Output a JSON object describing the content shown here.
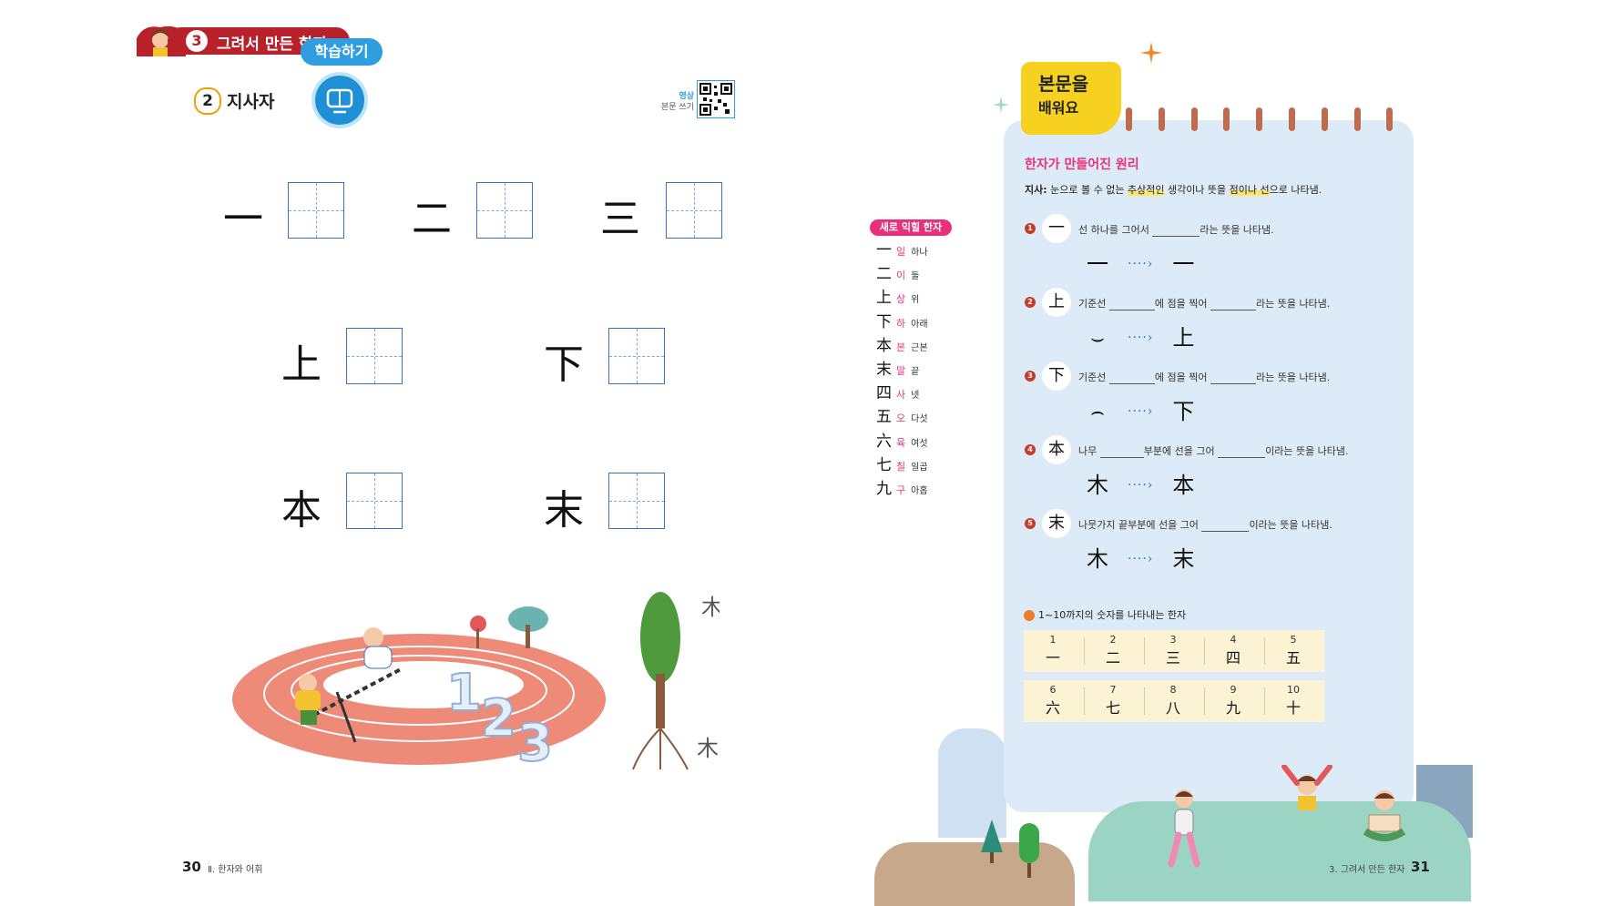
{
  "left_page": {
    "chapter_tab": {
      "number": "3",
      "title": "그려서 만든 한자"
    },
    "study_bubble": "학습하기",
    "section": {
      "number": "2",
      "title": "지사자"
    },
    "video": {
      "label1": "영상",
      "label2": "본문 쓰기"
    },
    "practice_row1": [
      "一",
      "二",
      "三"
    ],
    "practice_row2": [
      "上",
      "下"
    ],
    "practice_row3": [
      "本",
      "末"
    ],
    "illustration_numbers": [
      "1",
      "2",
      "3"
    ],
    "page_number": "30",
    "page_label": "Ⅱ. 한자와 어휘"
  },
  "right_page": {
    "new_hanja_title": "새로 익힐 한자",
    "new_hanja": [
      {
        "char": "一",
        "sound": "일",
        "meaning": "하나"
      },
      {
        "char": "二",
        "sound": "이",
        "meaning": "둘"
      },
      {
        "char": "上",
        "sound": "상",
        "meaning": "위"
      },
      {
        "char": "下",
        "sound": "하",
        "meaning": "아래"
      },
      {
        "char": "本",
        "sound": "본",
        "meaning": "근본"
      },
      {
        "char": "末",
        "sound": "말",
        "meaning": "끝"
      },
      {
        "char": "四",
        "sound": "사",
        "meaning": "넷"
      },
      {
        "char": "五",
        "sound": "오",
        "meaning": "다섯"
      },
      {
        "char": "六",
        "sound": "육",
        "meaning": "여섯"
      },
      {
        "char": "七",
        "sound": "칠",
        "meaning": "일곱"
      },
      {
        "char": "九",
        "sound": "구",
        "meaning": "아홉"
      }
    ],
    "badge": {
      "line1": "본문을",
      "line2": "배워요"
    },
    "principle_title": "한자가 만들어진 원리",
    "definition": {
      "term": "지사:",
      "part1": " 눈으로 볼 수 없는 ",
      "hl1": "추상적인",
      "part2": " 생각이나 뜻을 ",
      "hl2": "점이나 선",
      "part3": "으로 나타냄."
    },
    "items": [
      {
        "num": "1",
        "char": "一",
        "t1": "선 하나를 그어서",
        "t2": "라는 뜻을 나타냄.",
        "ancient": "一",
        "modern": "一"
      },
      {
        "num": "2",
        "char": "上",
        "t1": "기준선",
        "t2": "에 점을 찍어",
        "t3": "라는 뜻을 나타냄.",
        "ancient": "⌣",
        "modern": "上"
      },
      {
        "num": "3",
        "char": "下",
        "t1": "기준선",
        "t2": "에 점을 찍어",
        "t3": "라는 뜻을 나타냄.",
        "ancient": "⌢",
        "modern": "下"
      },
      {
        "num": "4",
        "char": "本",
        "t1": "나무",
        "t2": "부분에 선을 그어",
        "t3": "이라는 뜻을 나타냄.",
        "ancient": "木",
        "modern": "本"
      },
      {
        "num": "5",
        "char": "末",
        "t1": "나뭇가지 끝부분에 선을 그어",
        "t2": "이라는 뜻을 나타냄.",
        "ancient": "木",
        "modern": "末"
      }
    ],
    "arrow": "····›",
    "numbers_title": "1~10까지의 숫자를 나타내는 한자",
    "numbers_row1": [
      {
        "d": "1",
        "h": "一"
      },
      {
        "d": "2",
        "h": "二"
      },
      {
        "d": "3",
        "h": "三"
      },
      {
        "d": "4",
        "h": "四"
      },
      {
        "d": "5",
        "h": "五"
      }
    ],
    "numbers_row2": [
      {
        "d": "6",
        "h": "六"
      },
      {
        "d": "7",
        "h": "七"
      },
      {
        "d": "8",
        "h": "八"
      },
      {
        "d": "9",
        "h": "九"
      },
      {
        "d": "10",
        "h": "十"
      }
    ],
    "page_label": "3. 그려서 만든 한자",
    "page_number": "31"
  }
}
